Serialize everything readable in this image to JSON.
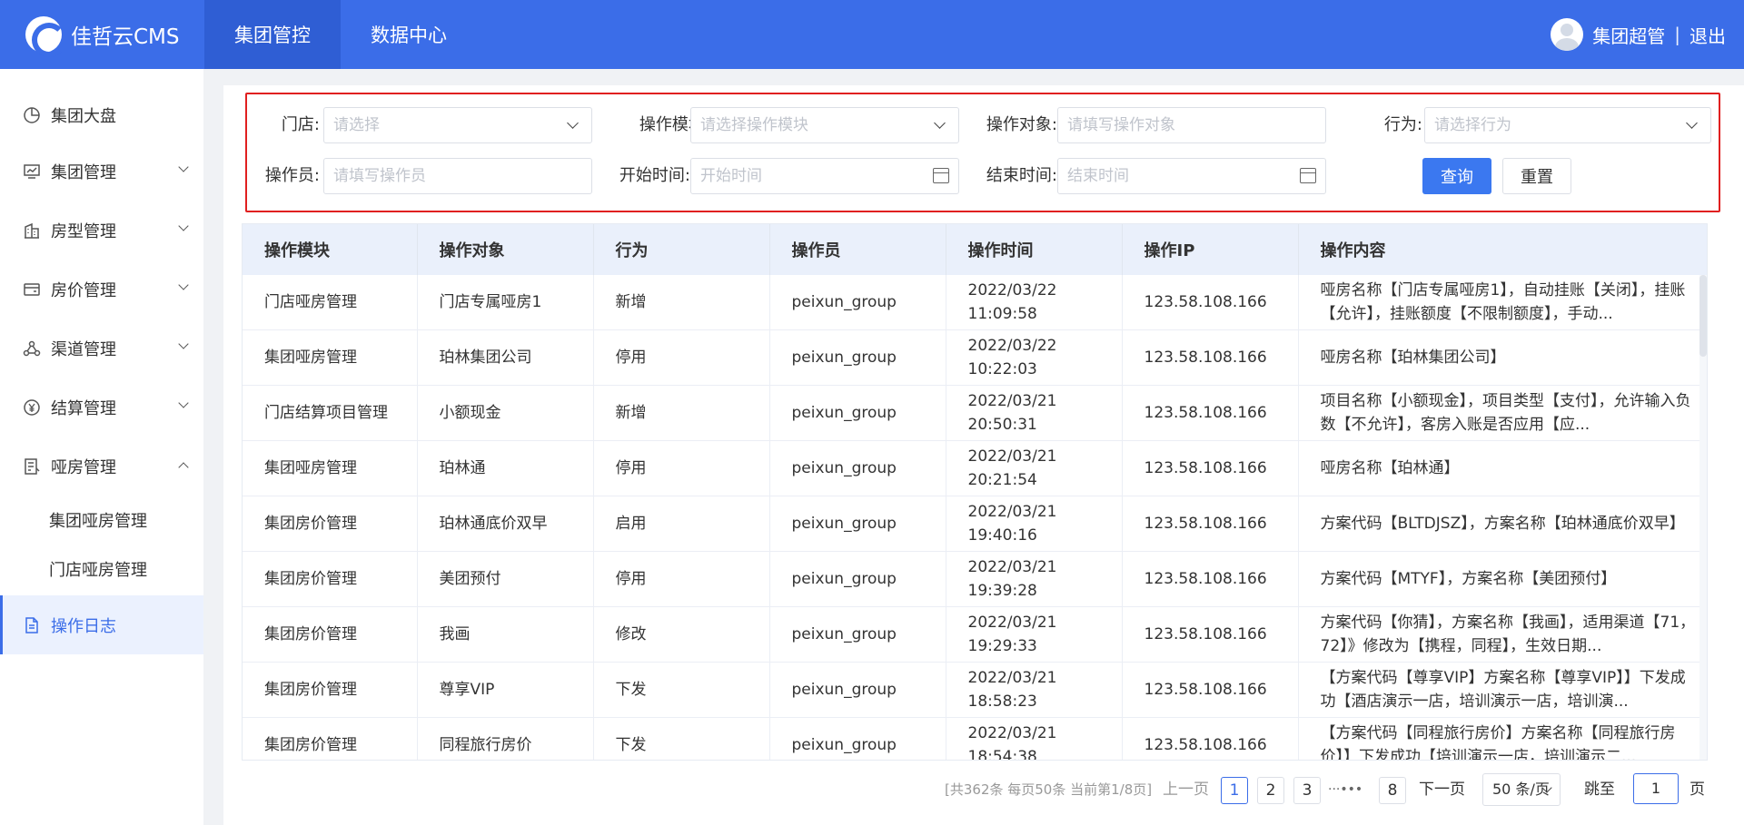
{
  "header": {
    "logo_text": "佳哲云CMS",
    "nav": [
      "集团管控",
      "数据中心"
    ],
    "user_name": "集团超管",
    "separator": "|",
    "logout": "退出"
  },
  "sidebar": {
    "items": [
      {
        "label": "集团大盘",
        "icon": "pie-chart-icon"
      },
      {
        "label": "集团管理",
        "icon": "monitor-icon"
      },
      {
        "label": "房型管理",
        "icon": "building-icon"
      },
      {
        "label": "房价管理",
        "icon": "wallet-icon"
      },
      {
        "label": "渠道管理",
        "icon": "network-icon"
      },
      {
        "label": "结算管理",
        "icon": "yen-icon"
      },
      {
        "label": "哑房管理",
        "icon": "document-icon"
      }
    ],
    "sub_items": [
      "集团哑房管理",
      "门店哑房管理"
    ],
    "active_item": {
      "label": "操作日志",
      "icon": "log-icon"
    }
  },
  "filters": {
    "store_label": "门店:",
    "store_placeholder": "请选择",
    "module_label": "操作模块:",
    "module_placeholder": "请选择操作模块",
    "target_label": "操作对象:",
    "target_placeholder": "请填写操作对象",
    "action_label": "行为:",
    "action_placeholder": "请选择行为",
    "operator_label": "操作员:",
    "operator_placeholder": "请填写操作员",
    "start_label": "开始时间:",
    "start_placeholder": "开始时间",
    "end_label": "结束时间:",
    "end_placeholder": "结束时间",
    "query_button": "查询",
    "reset_button": "重置"
  },
  "table": {
    "columns": [
      "操作模块",
      "操作对象",
      "行为",
      "操作员",
      "操作时间",
      "操作IP",
      "操作内容"
    ],
    "rows": [
      [
        "门店哑房管理",
        "门店专属哑房1",
        "新增",
        "peixun_group",
        "2022/03/22 11:09:58",
        "123.58.108.166",
        "哑房名称【门店专属哑房1】，自动挂账【关闭】，挂账【允许】，挂账额度【不限制额度】，手动..."
      ],
      [
        "集团哑房管理",
        "珀林集团公司",
        "停用",
        "peixun_group",
        "2022/03/22 10:22:03",
        "123.58.108.166",
        "哑房名称【珀林集团公司】"
      ],
      [
        "门店结算项目管理",
        "小额现金",
        "新增",
        "peixun_group",
        "2022/03/21 20:50:31",
        "123.58.108.166",
        "项目名称【小额现金】，项目类型【支付】，允许输入负数【不允许】，客房入账是否应用【应..."
      ],
      [
        "集团哑房管理",
        "珀林通",
        "停用",
        "peixun_group",
        "2022/03/21 20:21:54",
        "123.58.108.166",
        "哑房名称【珀林通】"
      ],
      [
        "集团房价管理",
        "珀林通底价双早",
        "启用",
        "peixun_group",
        "2022/03/21 19:40:16",
        "123.58.108.166",
        "方案代码【BLTDJSZ】，方案名称【珀林通底价双早】"
      ],
      [
        "集团房价管理",
        "美团预付",
        "停用",
        "peixun_group",
        "2022/03/21 19:39:28",
        "123.58.108.166",
        "方案代码【MTYF】，方案名称【美团预付】"
      ],
      [
        "集团房价管理",
        "我画",
        "修改",
        "peixun_group",
        "2022/03/21 19:29:33",
        "123.58.108.166",
        "方案代码【你猜】，方案名称【我画】，适用渠道【71，72】》修改为【携程，同程】，生效日期..."
      ],
      [
        "集团房价管理",
        "尊享VIP",
        "下发",
        "peixun_group",
        "2022/03/21 18:58:23",
        "123.58.108.166",
        "【方案代码【尊享VIP】方案名称【尊享VIP】】下发成功【酒店演示一店，培训演示一店，培训演..."
      ],
      [
        "集团房价管理",
        "同程旅行房价",
        "下发",
        "peixun_group",
        "2022/03/21 18:54:38",
        "123.58.108.166",
        "【方案代码【同程旅行房价】方案名称【同程旅行房价】】下发成功【培训演示一店，培训演示二..."
      ]
    ]
  },
  "pagination": {
    "summary": "[共362条 每页50条 当前第1/8页]",
    "prev": "上一页",
    "pages": [
      "1",
      "2",
      "3"
    ],
    "ellipsis": "···•••",
    "last_page": "8",
    "next": "下一页",
    "page_size": "50 条/页",
    "jump_label": "跳至",
    "jump_value": "1",
    "page_unit": "页"
  }
}
